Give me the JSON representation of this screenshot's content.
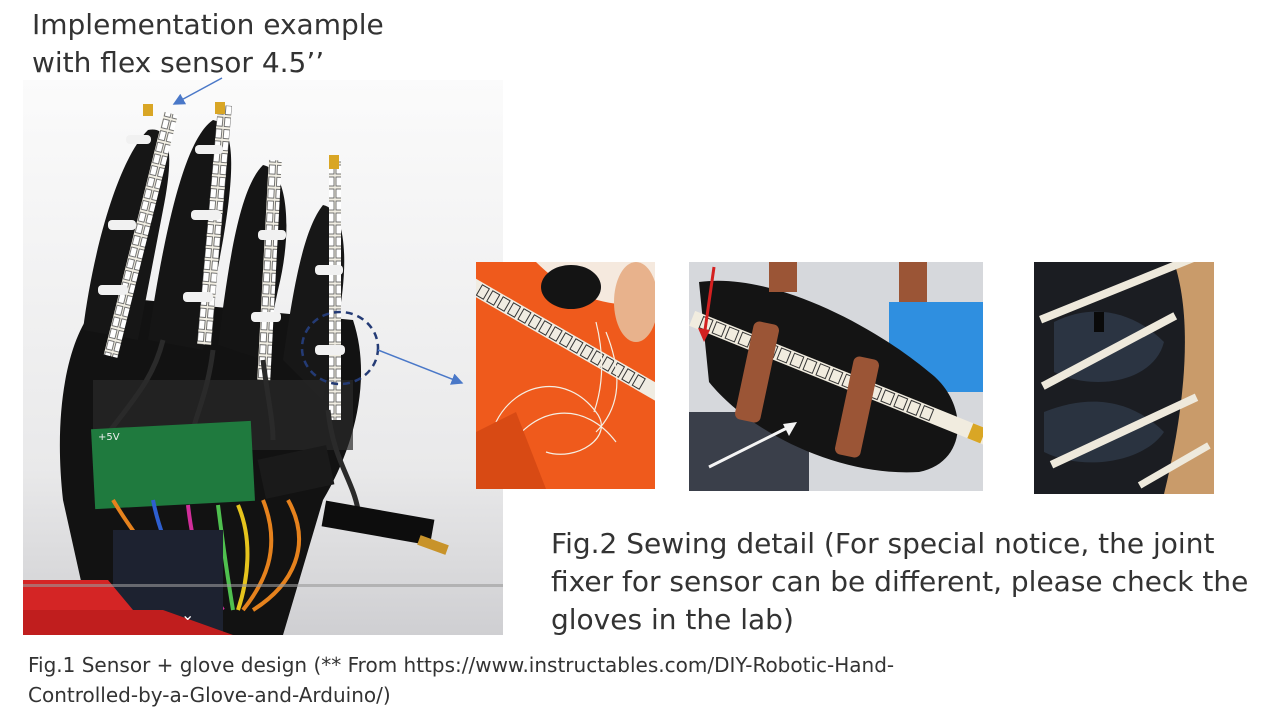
{
  "slide": {
    "title_lines": [
      "Implementation example",
      "with flex sensor 4.5’’"
    ],
    "fig2_caption_lines": [
      "Fig.2 Sewing detail (For special notice, the joint",
      "fixer for sensor can be different, please check the",
      "gloves in the lab)"
    ],
    "fig1_caption_lines": [
      "Fig.1 Sensor + glove design (** From https://www.instructables.com/DIY-Robotic-Hand-",
      "Controlled-by-a-Glove-and-Arduino/)"
    ],
    "board_label": "+5V",
    "colors": {
      "glove": "#141414",
      "sensor_strip": "#e9ddb0",
      "orange_fabric": "#ef5a1c",
      "leather_strap": "#9b5536",
      "arrow": "#4a78c8",
      "pcb": "#1f7a3e"
    }
  }
}
